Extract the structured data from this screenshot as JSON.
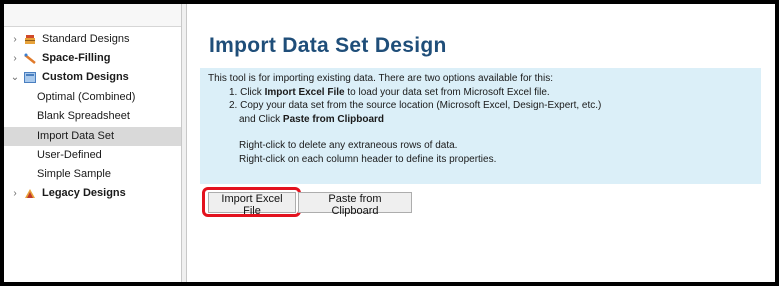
{
  "sidebar": {
    "items": [
      {
        "label": "Standard Designs",
        "icon": "standard-designs-icon",
        "expanded": false
      },
      {
        "label": "Space-Filling",
        "icon": "space-filling-icon",
        "expanded": false
      },
      {
        "label": "Custom Designs",
        "icon": "custom-designs-icon",
        "expanded": true
      },
      {
        "label": "Optimal (Combined)"
      },
      {
        "label": "Blank Spreadsheet"
      },
      {
        "label": "Import Data Set",
        "selected": true
      },
      {
        "label": "User-Defined"
      },
      {
        "label": "Simple Sample"
      },
      {
        "label": "Legacy Designs",
        "icon": "legacy-designs-icon",
        "expanded": false
      }
    ]
  },
  "main": {
    "title": "Import Data Set Design",
    "info": {
      "intro": "This tool is for importing existing data. There are two options available for this:",
      "step1_prefix": "1. Click ",
      "step1_bold": "Import Excel File",
      "step1_suffix": " to load your data set from Microsoft Excel file.",
      "step2_line1": "2. Copy your data set from the source location (Microsoft Excel, Design-Expert, etc.)",
      "step2_prefix": "and Click ",
      "step2_bold": "Paste from Clipboard",
      "note1": "Right-click to delete any extraneous rows of data.",
      "note2": "Right-click on each column header to define its properties."
    },
    "buttons": {
      "import_label": "Import Excel File",
      "paste_label": "Paste from Clipboard"
    }
  },
  "colors": {
    "title": "#1f4e79",
    "info_background": "#dbeff8",
    "highlight": "#e3121e",
    "selected_row": "#d9d9d9"
  }
}
